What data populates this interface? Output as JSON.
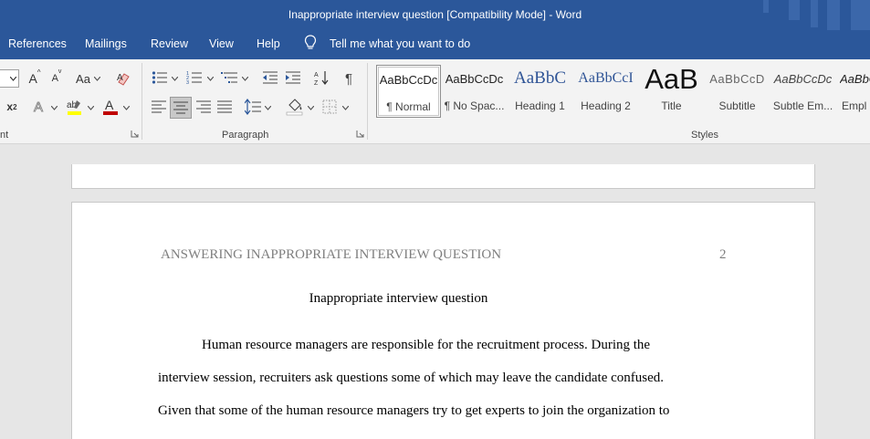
{
  "window": {
    "title": "Inappropriate interview question [Compatibility Mode]  -  Word"
  },
  "menu": {
    "tabs": [
      "References",
      "Mailings",
      "Review",
      "View",
      "Help"
    ],
    "tell_me": "Tell me what you want to do"
  },
  "ribbon": {
    "groups": {
      "font": "nt",
      "paragraph": "Paragraph",
      "styles": "Styles"
    },
    "font_size_value": "",
    "change_case_label": "Aa",
    "styles": [
      {
        "sample": "AaBbCcDc",
        "name": "¶ Normal"
      },
      {
        "sample": "AaBbCcDc",
        "name": "¶ No Spac..."
      },
      {
        "sample": "AaBbC",
        "name": "Heading 1"
      },
      {
        "sample": "AaBbCcI",
        "name": "Heading 2"
      },
      {
        "sample": "AaB",
        "name": "Title"
      },
      {
        "sample": "AaBbCcD",
        "name": "Subtitle"
      },
      {
        "sample": "AaBbCcDc",
        "name": "Subtle Em..."
      },
      {
        "sample": "AaBbC",
        "name": "Empl"
      }
    ]
  },
  "document": {
    "running_head": "ANSWERING INAPPROPRIATE INTERVIEW QUESTION",
    "page_number": "2",
    "heading": "Inappropriate interview question",
    "lines": [
      "Human resource managers are responsible for the recruitment process. During the",
      "interview session, recruiters ask questions some of which may leave the candidate confused.",
      "Given that some of the human resource managers try to get experts to join the organization to"
    ]
  },
  "colors": {
    "title_bar": "#2b579a",
    "ribbon_bg": "#f3f3f3",
    "canvas_bg": "#e6e6e6",
    "heading_blue": "#2f5496",
    "highlight_yellow": "#ffff00",
    "font_color_red": "#c00000"
  }
}
